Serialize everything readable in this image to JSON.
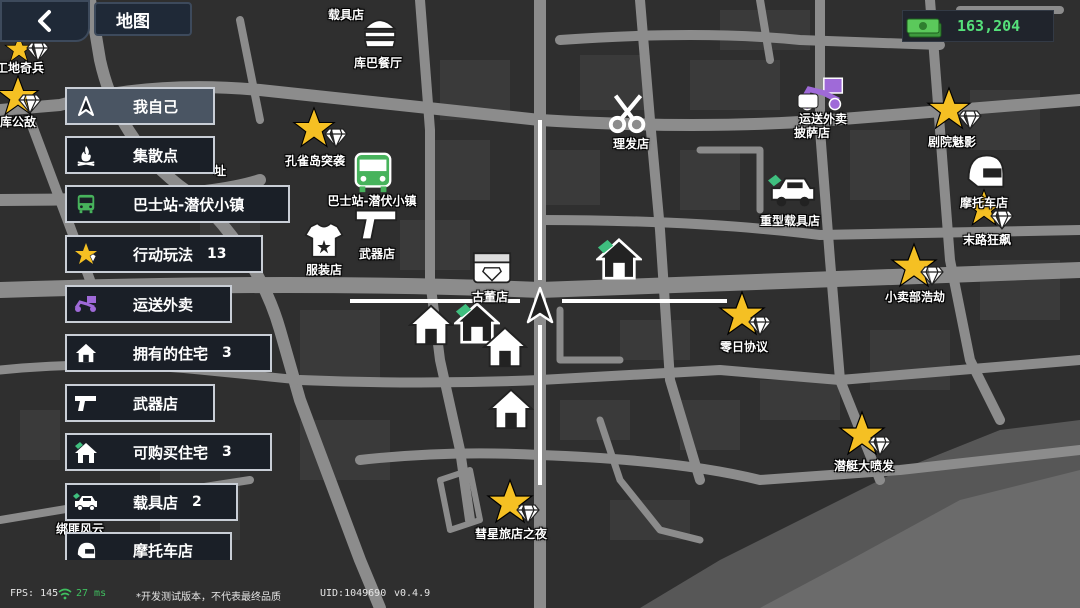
{
  "header": {
    "title": "地图"
  },
  "wallet": {
    "amount": "163,204"
  },
  "menu": [
    {
      "label": "我自己",
      "count": ""
    },
    {
      "label": "集散点",
      "count": ""
    },
    {
      "label": "巴士站-潜伏小镇",
      "count": ""
    },
    {
      "label": "行动玩法",
      "count": "13"
    },
    {
      "label": "运送外卖",
      "count": ""
    },
    {
      "label": "拥有的住宅",
      "count": "3"
    },
    {
      "label": "武器店",
      "count": ""
    },
    {
      "label": "可购买住宅",
      "count": "3"
    },
    {
      "label": "载具店",
      "count": "2"
    },
    {
      "label": "摩托车店",
      "count": ""
    }
  ],
  "map_labels": {
    "vehicle_shop_top": "载具店",
    "burger": "库巴餐厅",
    "peacock": "孔雀岛突袭",
    "bus_stop": "巴士站-潜伏小镇",
    "weapon_shop": "武器店",
    "clothing": "服装店",
    "antique": "古董店",
    "barber": "理发店",
    "delivery": "运送外卖",
    "pizza": "披萨店",
    "heavy_vehicle": "重型载具店",
    "theater": "剧院魅影",
    "moto_shop": "摩托车店",
    "last_road": "末路狂飙",
    "shop_plot": "小卖部浩劫",
    "zero_day": "零日协议",
    "submarine": "潜艇大喷发",
    "comet_hotel": "彗星旅店之夜",
    "site_soldier": "工地奇兵",
    "vault": "库公敌",
    "edge1": "址",
    "edge2": "绑匪风云"
  },
  "status": {
    "fps": "FPS: 145",
    "ping": "27 ms",
    "notice": "*开发测试版本，不代表最终品质",
    "uid": "UID:1049690",
    "version": "v0.4.9"
  }
}
